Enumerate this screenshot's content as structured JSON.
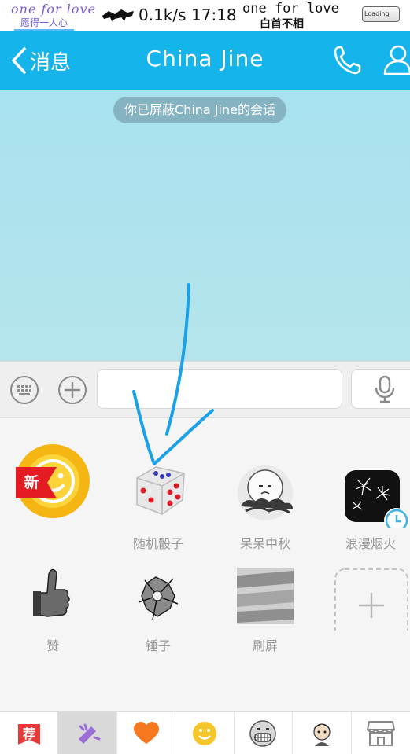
{
  "status_bar": {
    "deco_left_top": "one for love",
    "deco_left_bottom": "愿得一人心",
    "speed": "0.1k/s",
    "time": "17:18",
    "deco_right_top": "one for love",
    "deco_right_bottom": "白首不相",
    "loading_text": "Loading"
  },
  "header": {
    "back_label": "消息",
    "title": "China   Jine",
    "color": "#15b5ec"
  },
  "chat": {
    "notice": "你已屏蔽China  Jine的会话"
  },
  "input_bar": {
    "text_value": ""
  },
  "emoji_panel": {
    "new_badge": "新",
    "items": [
      {
        "label": "",
        "icon": "smiley-face-icon"
      },
      {
        "label": "随机骰子",
        "icon": "dice-icon"
      },
      {
        "label": "呆呆中秋",
        "icon": "moon-cloud-icon"
      },
      {
        "label": "浪漫烟火",
        "icon": "fireworks-icon"
      },
      {
        "label": "赞",
        "icon": "thumbs-up-icon"
      },
      {
        "label": "锤子",
        "icon": "hammer-crack-icon"
      },
      {
        "label": "刷屏",
        "icon": "brush-screen-icon"
      },
      {
        "label": "",
        "icon": "add-icon"
      }
    ]
  },
  "tabbar": {
    "recommend_label": "荐",
    "tabs": [
      "recommend-icon",
      "magic-icon",
      "heart-icon",
      "emoji-icon",
      "grin-icon",
      "avatar-icon",
      "store-icon"
    ]
  }
}
